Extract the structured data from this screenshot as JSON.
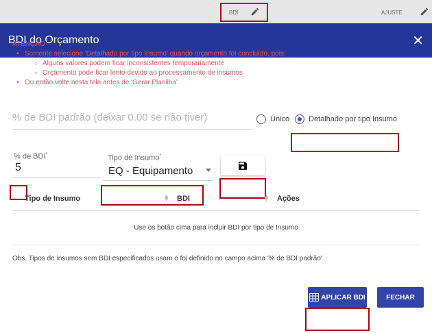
{
  "background": {
    "bdi_label": "BDI",
    "ajuste_label": "AJUSTE"
  },
  "modal": {
    "title": "BDI do Orçamento",
    "close_icon": "close-icon",
    "warning": {
      "heading": "ATENÇÃO",
      "items": [
        "Somente selecione 'Detalhado por tipo Insumo' quando orçamento foi concluído, pois:",
        "Alguns valores podem ficar inconsistentes temporariamente",
        "Orçamento pode ficar lento devido ao processamento de insumos",
        "Ou então volte nesta tela antes de 'Gerar Planilha'"
      ]
    },
    "default_bdi_placeholder": "% de BDI padrão (deixar 0.00 se não tiver)",
    "radio_unico": "Único",
    "radio_detalhado": "Detalhado por tipo Insumo",
    "pct_label": "% de BDI",
    "pct_value": "5",
    "tipo_label": "Tipo de Insumo",
    "tipo_value": "EQ - Equipamento",
    "required_mark": "*",
    "table": {
      "columns": [
        "Tipo de Insumo",
        "BDI",
        "Ações"
      ],
      "empty_message": "Use os botão cima para incluir BDI por tipo de Insumo"
    },
    "obs": "Obs. Tipos de insumos sem BDI especificados usam o foi definido no campo acima '% de BDI padrão'",
    "apply_button": "APLICAR BDI",
    "close_button": "FECHAR"
  },
  "colors": {
    "header": "#26359a",
    "button": "#3344a8",
    "warning": "#e3555f",
    "highlight": "#b00010"
  }
}
